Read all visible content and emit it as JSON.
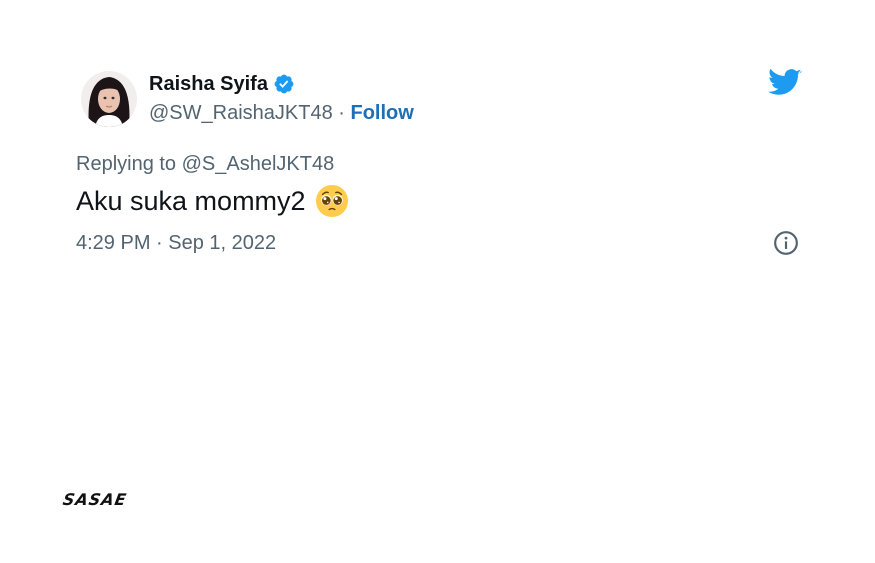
{
  "tweet": {
    "author": {
      "display_name": "Raisha Syifa",
      "handle": "@SW_RaishaJKT48",
      "separator": "·",
      "follow_label": "Follow",
      "verified": true
    },
    "replying_to": "Replying to @S_AshelJKT48",
    "text": "Aku suka mommy2",
    "emoji": "pleading-face-emoji",
    "timestamp": "4:29 PM · Sep 1, 2022"
  },
  "icons": {
    "twitter": "twitter-bird-icon",
    "info": "info-icon",
    "verified": "verified-badge-icon"
  },
  "colors": {
    "twitter_blue": "#1d9bf0",
    "follow_link": "#1d6fb8",
    "text_primary": "#0f1419",
    "text_secondary": "#536471"
  },
  "watermark": {
    "logo": "SASAE"
  }
}
